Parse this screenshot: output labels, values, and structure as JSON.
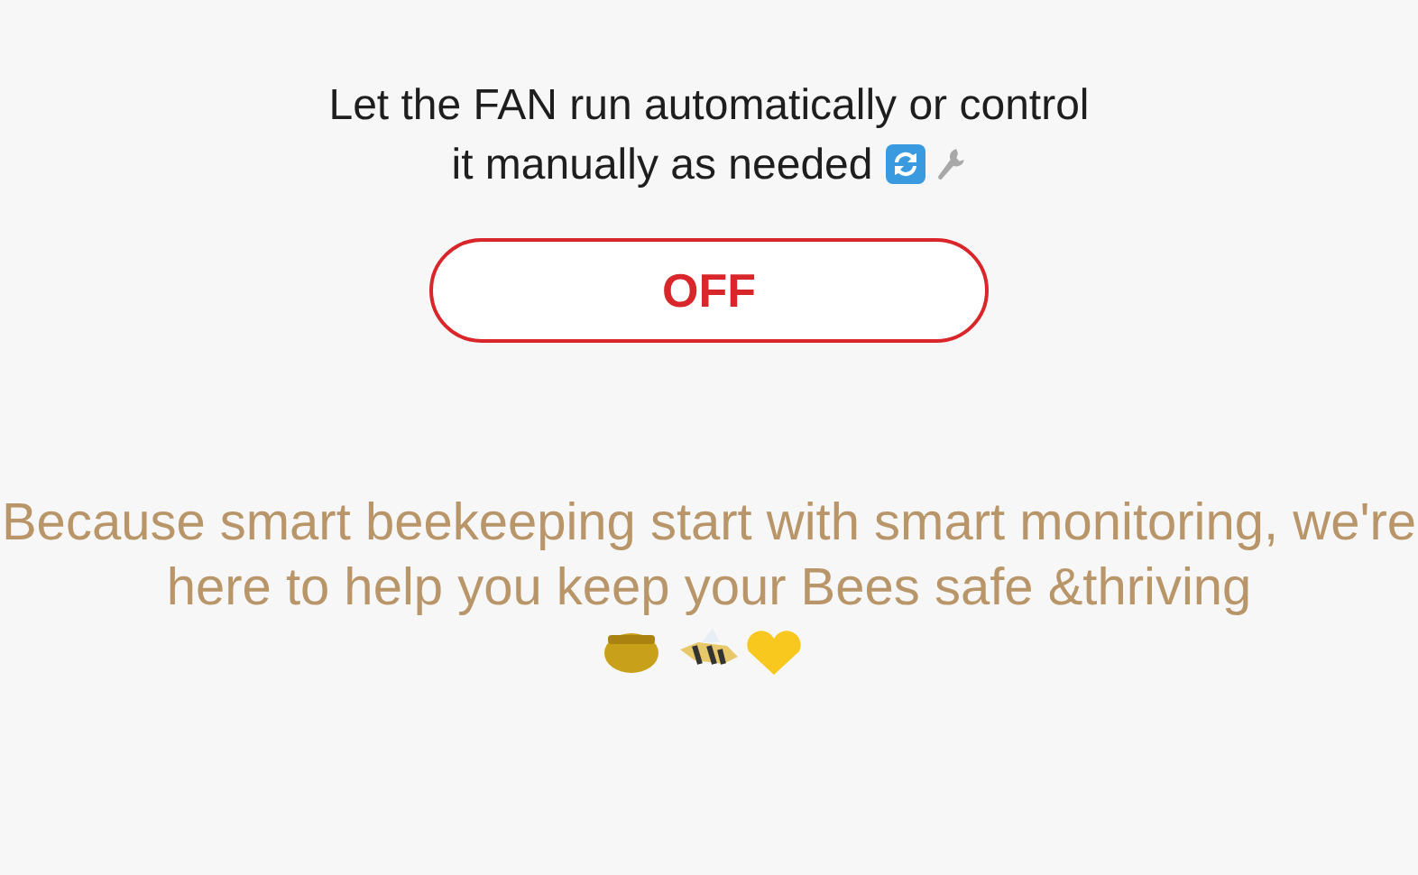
{
  "fan_prompt": "Let the FAN run automatically or control it manually as needed",
  "fan_toggle": {
    "label": "OFF",
    "on": false
  },
  "tagline": "Because smart beekeeping start with smart monitoring, we're here to help you keep your Bees safe &thriving"
}
